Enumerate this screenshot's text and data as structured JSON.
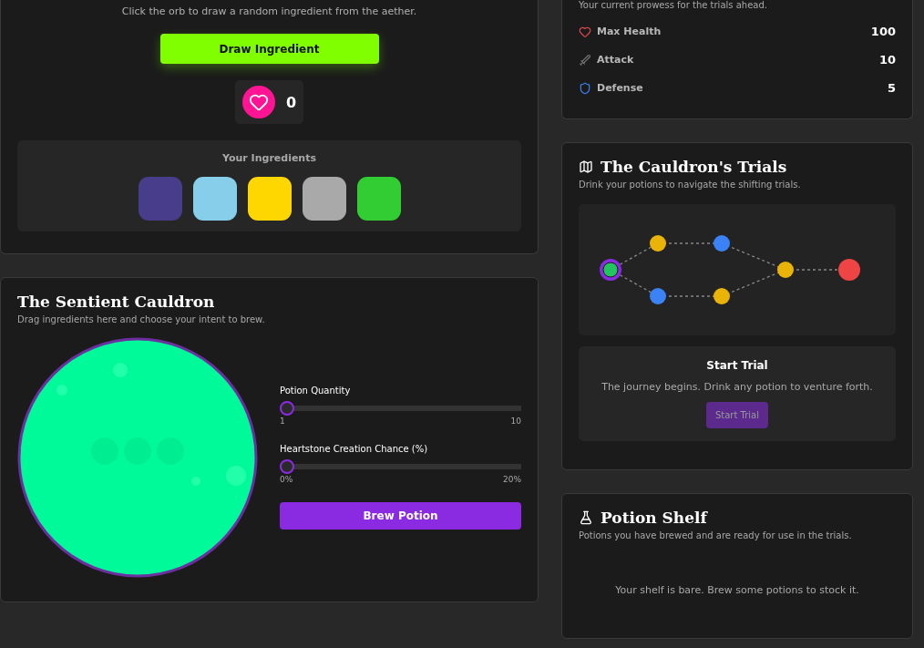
{
  "draw_panel": {
    "hint": "Click the orb to draw a random ingredient from the aether.",
    "button": "Draw Ingredient",
    "heartstones": "0",
    "ingredients_title": "Your Ingredients",
    "ingredients": [
      {
        "color": "#483d8b"
      },
      {
        "color": "#87ceeb"
      },
      {
        "color": "#ffd700"
      },
      {
        "color": "#a9a9a9"
      },
      {
        "color": "#32cd32"
      }
    ]
  },
  "cauldron": {
    "title": "The Sentient Cauldron",
    "subtitle": "Drag ingredients here and choose your intent to brew.",
    "sliders": [
      {
        "label": "Potion Quantity",
        "level": 0,
        "min": "1",
        "max": "10"
      },
      {
        "label": "Heartstone Creation Chance (%)",
        "level": 0,
        "min": "0%",
        "max": "20%"
      }
    ],
    "button": "Brew Potion"
  },
  "stats": {
    "subtitle": "Your current prowess for the trials ahead.",
    "items": [
      {
        "kind": "health",
        "label": "Max Health",
        "value": "100"
      },
      {
        "kind": "attack",
        "label": "Attack",
        "value": "10"
      },
      {
        "kind": "defense",
        "label": "Defense",
        "value": "5"
      }
    ]
  },
  "trials": {
    "title": "The Cauldron's Trials",
    "subtitle": "Drink your potions to navigate the shifting trials.",
    "nodes": [
      {
        "color": "#22c55e",
        "selected": true
      },
      {
        "color": "#eab308",
        "selected": false
      },
      {
        "color": "#3b82f6",
        "selected": false
      },
      {
        "color": "#3b82f6",
        "selected": false
      },
      {
        "color": "#eab308",
        "selected": false
      },
      {
        "color": "#eab308",
        "selected": false
      },
      {
        "color": "#ef4444",
        "selected": false
      }
    ],
    "box_title": "Start Trial",
    "box_text": "The journey begins. Drink any potion to venture forth.",
    "button": "Start Trial",
    "button_disabled": true
  },
  "shelf": {
    "title": "Potion Shelf",
    "subtitle": "Potions you have brewed and are ready for use in the trials.",
    "empty": "Your shelf is bare. Brew some potions to stock it."
  }
}
